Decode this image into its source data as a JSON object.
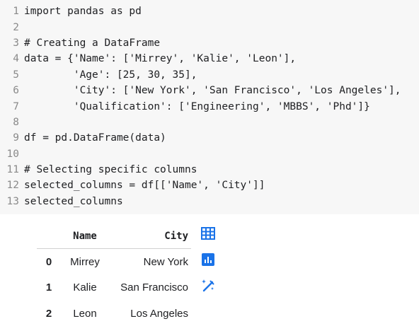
{
  "code_cell": {
    "lines": [
      {
        "num": "1",
        "text": "import pandas as pd"
      },
      {
        "num": "2",
        "text": ""
      },
      {
        "num": "3",
        "text": "# Creating a DataFrame"
      },
      {
        "num": "4",
        "text": "data = {'Name': ['Mirrey', 'Kalie', 'Leon'],"
      },
      {
        "num": "5",
        "text": "        'Age': [25, 30, 35],"
      },
      {
        "num": "6",
        "text": "        'City': ['New York', 'San Francisco', 'Los Angeles'],"
      },
      {
        "num": "7",
        "text": "        'Qualification': ['Engineering', 'MBBS', 'Phd']}"
      },
      {
        "num": "8",
        "text": ""
      },
      {
        "num": "9",
        "text": "df = pd.DataFrame(data)"
      },
      {
        "num": "10",
        "text": ""
      },
      {
        "num": "11",
        "text": "# Selecting specific columns"
      },
      {
        "num": "12",
        "text": "selected_columns = df[['Name', 'City']]"
      },
      {
        "num": "13",
        "text": "selected_columns"
      }
    ]
  },
  "output_table": {
    "columns": [
      "Name",
      "City"
    ],
    "rows": [
      {
        "index": "0",
        "name": "Mirrey",
        "city": "New York"
      },
      {
        "index": "1",
        "name": "Kalie",
        "city": "San Francisco"
      },
      {
        "index": "2",
        "name": "Leon",
        "city": "Los Angeles"
      }
    ]
  },
  "output_actions": {
    "icons": [
      "table-view-icon",
      "chart-suggest-icon",
      "magic-wand-icon"
    ],
    "accent_color": "#1a73e8"
  }
}
